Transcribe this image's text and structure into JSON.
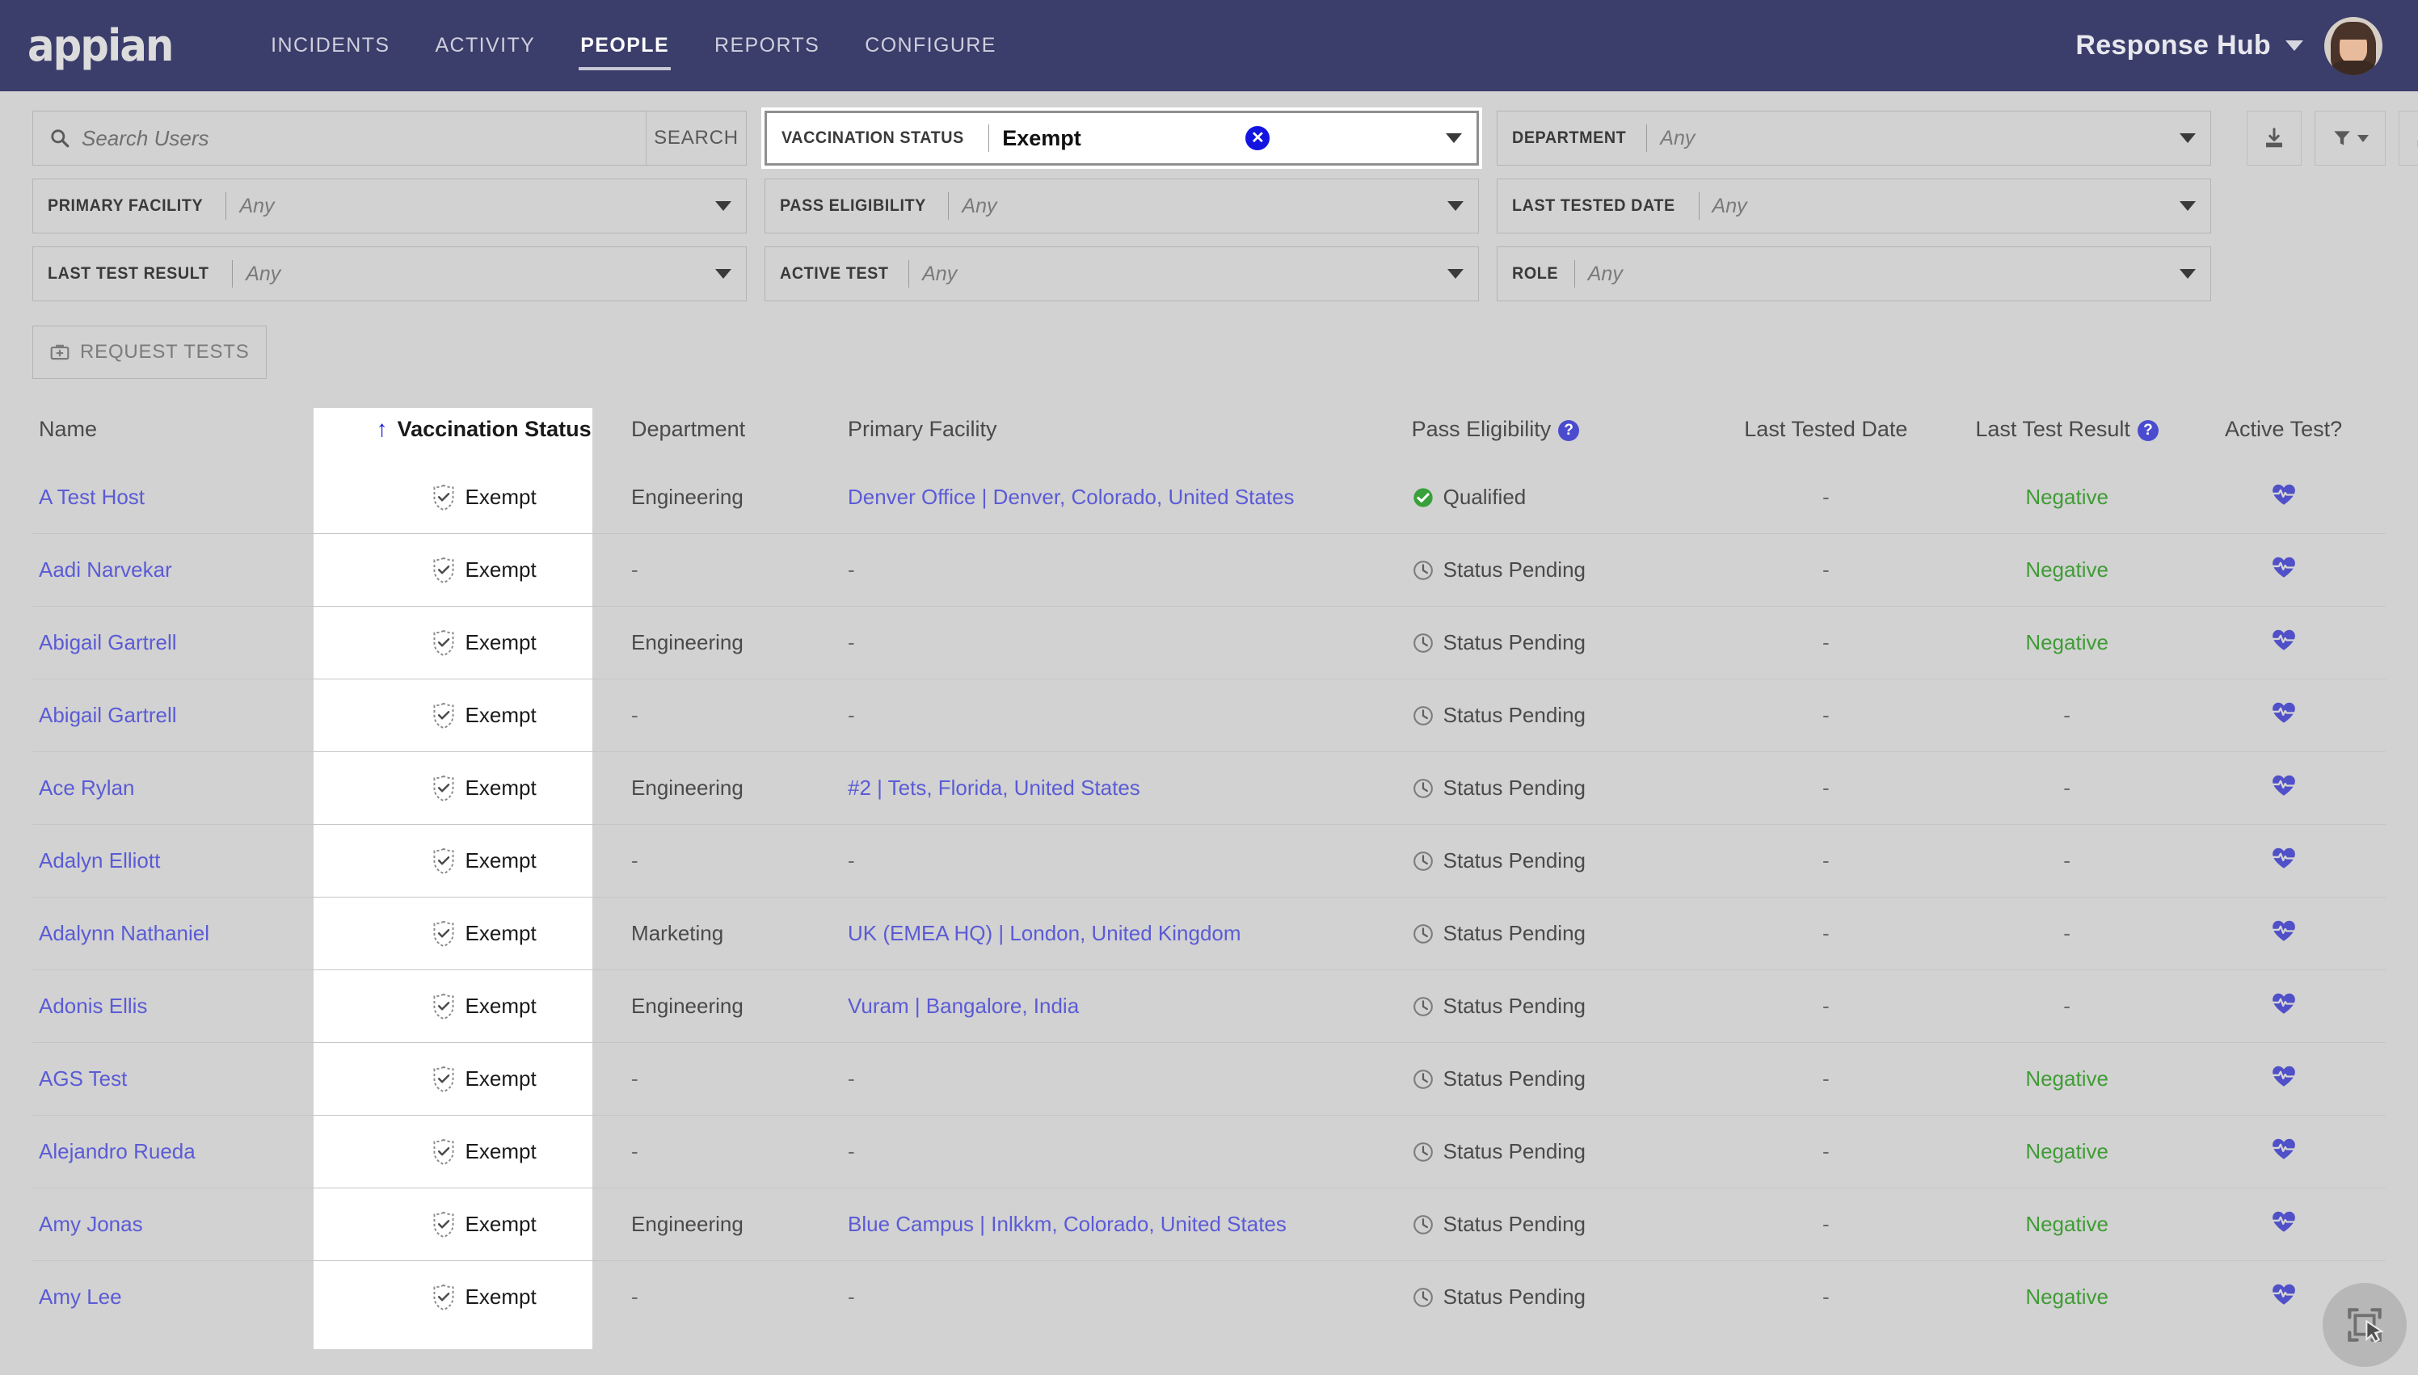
{
  "header": {
    "logo": "appian",
    "nav": [
      {
        "label": "INCIDENTS",
        "active": false
      },
      {
        "label": "ACTIVITY",
        "active": false
      },
      {
        "label": "PEOPLE",
        "active": true
      },
      {
        "label": "REPORTS",
        "active": false
      },
      {
        "label": "CONFIGURE",
        "active": false
      }
    ],
    "site_name": "Response Hub",
    "avatar_name": "user-avatar"
  },
  "search": {
    "placeholder": "Search Users",
    "value": "",
    "button_label": "SEARCH",
    "icon": "search-icon"
  },
  "filters": [
    {
      "label": "VACCINATION STATUS",
      "value": "Exempt",
      "placeholder": "Any",
      "active": true,
      "clearable": true
    },
    {
      "label": "DEPARTMENT",
      "value": "",
      "placeholder": "Any",
      "active": false,
      "clearable": false
    },
    {
      "label": "PRIMARY FACILITY",
      "value": "",
      "placeholder": "Any",
      "active": false,
      "clearable": false
    },
    {
      "label": "PASS ELIGIBILITY",
      "value": "",
      "placeholder": "Any",
      "active": false,
      "clearable": false
    },
    {
      "label": "LAST TESTED DATE",
      "value": "",
      "placeholder": "Any",
      "active": false,
      "clearable": false
    },
    {
      "label": "LAST TEST RESULT",
      "value": "",
      "placeholder": "Any",
      "active": false,
      "clearable": false
    },
    {
      "label": "ACTIVE TEST",
      "value": "",
      "placeholder": "Any",
      "active": false,
      "clearable": false
    },
    {
      "label": "ROLE",
      "value": "",
      "placeholder": "Any",
      "active": false,
      "clearable": false
    }
  ],
  "toolbar_icons": [
    {
      "name": "download-icon"
    },
    {
      "name": "funnel-filter-icon"
    },
    {
      "name": "refresh-icon"
    }
  ],
  "actions": {
    "request_tests_label": "REQUEST TESTS",
    "request_tests_icon": "medical-kit-icon"
  },
  "table": {
    "columns": [
      {
        "key": "name",
        "label": "Name",
        "help": false,
        "sorted": false
      },
      {
        "key": "vax",
        "label": "Vaccination Status",
        "help": false,
        "sorted": true,
        "sort_dir": "asc"
      },
      {
        "key": "dept",
        "label": "Department",
        "help": false,
        "sorted": false
      },
      {
        "key": "fac",
        "label": "Primary Facility",
        "help": false,
        "sorted": false
      },
      {
        "key": "pass",
        "label": "Pass Eligibility",
        "help": true,
        "sorted": false
      },
      {
        "key": "ltd",
        "label": "Last Tested Date",
        "help": false,
        "sorted": false
      },
      {
        "key": "ltr",
        "label": "Last Test Result",
        "help": true,
        "sorted": false
      },
      {
        "key": "act",
        "label": "Active Test?",
        "help": false,
        "sorted": false
      }
    ],
    "rows": [
      {
        "name": "A Test Host",
        "vax": "Exempt",
        "dept": "Engineering",
        "fac": "Denver Office | Denver, Colorado, United States",
        "pass": "Qualified",
        "pass_icon": "check-circle-icon",
        "ltd": "-",
        "ltr": "Negative",
        "act": "heart-pulse-icon"
      },
      {
        "name": "Aadi Narvekar",
        "vax": "Exempt",
        "dept": "-",
        "fac": "-",
        "pass": "Status Pending",
        "pass_icon": "clock-icon",
        "ltd": "-",
        "ltr": "Negative",
        "act": "heart-pulse-icon"
      },
      {
        "name": "Abigail Gartrell",
        "vax": "Exempt",
        "dept": "Engineering",
        "fac": "-",
        "pass": "Status Pending",
        "pass_icon": "clock-icon",
        "ltd": "-",
        "ltr": "Negative",
        "act": "heart-pulse-icon"
      },
      {
        "name": "Abigail Gartrell",
        "vax": "Exempt",
        "dept": "-",
        "fac": "-",
        "pass": "Status Pending",
        "pass_icon": "clock-icon",
        "ltd": "-",
        "ltr": "-",
        "act": "heart-pulse-icon"
      },
      {
        "name": "Ace Rylan",
        "vax": "Exempt",
        "dept": "Engineering",
        "fac": "#2 | Tets, Florida, United States",
        "pass": "Status Pending",
        "pass_icon": "clock-icon",
        "ltd": "-",
        "ltr": "-",
        "act": "heart-pulse-icon"
      },
      {
        "name": "Adalyn Elliott",
        "vax": "Exempt",
        "dept": "-",
        "fac": "-",
        "pass": "Status Pending",
        "pass_icon": "clock-icon",
        "ltd": "-",
        "ltr": "-",
        "act": "heart-pulse-icon"
      },
      {
        "name": "Adalynn Nathaniel",
        "vax": "Exempt",
        "dept": "Marketing",
        "fac": "UK (EMEA HQ) | London, United Kingdom",
        "pass": "Status Pending",
        "pass_icon": "clock-icon",
        "ltd": "-",
        "ltr": "-",
        "act": "heart-pulse-icon"
      },
      {
        "name": "Adonis Ellis",
        "vax": "Exempt",
        "dept": "Engineering",
        "fac": "Vuram | Bangalore, India",
        "pass": "Status Pending",
        "pass_icon": "clock-icon",
        "ltd": "-",
        "ltr": "-",
        "act": "heart-pulse-icon"
      },
      {
        "name": "AGS Test",
        "vax": "Exempt",
        "dept": "-",
        "fac": "-",
        "pass": "Status Pending",
        "pass_icon": "clock-icon",
        "ltd": "-",
        "ltr": "Negative",
        "act": "heart-pulse-icon"
      },
      {
        "name": "Alejandro Rueda",
        "vax": "Exempt",
        "dept": "-",
        "fac": "-",
        "pass": "Status Pending",
        "pass_icon": "clock-icon",
        "ltd": "-",
        "ltr": "Negative",
        "act": "heart-pulse-icon"
      },
      {
        "name": "Amy Jonas",
        "vax": "Exempt",
        "dept": "Engineering",
        "fac": "Blue Campus | Inlkkm, Colorado, United States",
        "pass": "Status Pending",
        "pass_icon": "clock-icon",
        "ltd": "-",
        "ltr": "Negative",
        "act": "heart-pulse-icon"
      },
      {
        "name": "Amy Lee",
        "vax": "Exempt",
        "dept": "-",
        "fac": "-",
        "pass": "Status Pending",
        "pass_icon": "clock-icon",
        "ltd": "-",
        "ltr": "Negative",
        "act": "heart-pulse-icon"
      }
    ]
  },
  "colors": {
    "header_bg": "#3b3d6b",
    "page_bg": "#d2d2d2",
    "link": "#5b5bd6",
    "positive_green": "#3f9c35",
    "accent_blue": "#1414e0",
    "heart_purple": "#5050c8"
  },
  "overlay": {
    "cursor_badge_icon": "screenshot-cursor-icon"
  }
}
